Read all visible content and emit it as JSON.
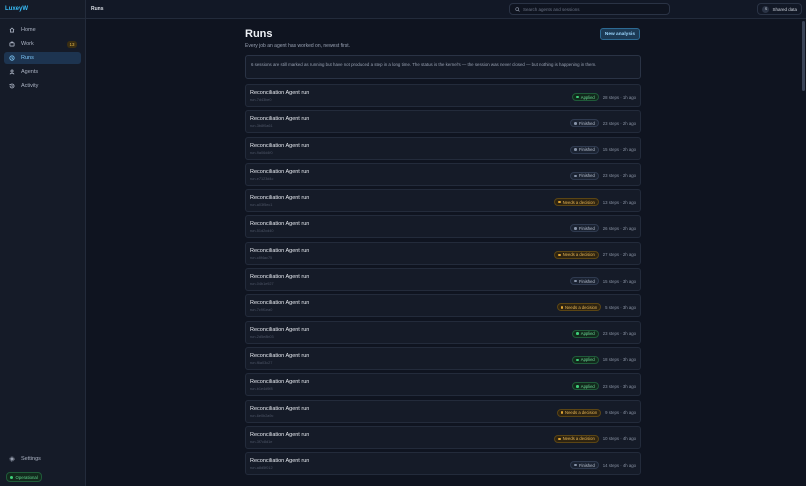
{
  "app": {
    "brand": "LuxeyW"
  },
  "sidebar": {
    "items": [
      {
        "label": "Home",
        "icon": "home-icon"
      },
      {
        "label": "Work",
        "icon": "briefcase-icon",
        "badge": "13"
      },
      {
        "label": "Runs",
        "icon": "clock-icon",
        "active": true
      },
      {
        "label": "Agents",
        "icon": "user-icon"
      },
      {
        "label": "Activity",
        "icon": "history-icon"
      }
    ],
    "settings_label": "Settings",
    "status_label": "Operational"
  },
  "topbar": {
    "breadcrumb": "Runs",
    "search_placeholder": "Search agents and sessions",
    "shared_avatar": "S",
    "shared_label": "Shared data"
  },
  "page": {
    "title": "Runs",
    "subtitle": "Every job an agent has worked on, newest first.",
    "new_button": "New analysis",
    "notice": "6 sessions are still marked as running but have not produced a step in a long time. The status is the kernel's — the session was never closed — but nothing is happening in them."
  },
  "runs": [
    {
      "title": "Reconciliation Agent run",
      "id": "run-7d43be0",
      "status": "Applied",
      "kind": "applied",
      "stats": "28 steps · 1h ago"
    },
    {
      "title": "Reconciliation Agent run",
      "id": "run-3b8f0a61",
      "status": "Finished",
      "kind": "finished",
      "stats": "23 steps · 2h ago"
    },
    {
      "title": "Reconciliation Agent run",
      "id": "run-9a06d4f0",
      "status": "Finished",
      "kind": "finished",
      "stats": "15 steps · 2h ago"
    },
    {
      "title": "Reconciliation Agent run",
      "id": "run-e7123d4c",
      "status": "Finished",
      "kind": "finished",
      "stats": "23 steps · 2h ago"
    },
    {
      "title": "Reconciliation Agent run",
      "id": "run-a03f5ec1",
      "status": "Needs a decision",
      "kind": "decision",
      "stats": "13 steps · 2h ago"
    },
    {
      "title": "Reconciliation Agent run",
      "id": "run-51d2cd40",
      "status": "Finished",
      "kind": "finished",
      "stats": "26 steps · 2h ago"
    },
    {
      "title": "Reconciliation Agent run",
      "id": "run-c8f4ac75",
      "status": "Needs a decision",
      "kind": "decision",
      "stats": "27 steps · 2h ago"
    },
    {
      "title": "Reconciliation Agent run",
      "id": "run-04b1e927",
      "status": "Finished",
      "kind": "finished",
      "stats": "15 steps · 3h ago"
    },
    {
      "title": "Reconciliation Agent run",
      "id": "run-7c9f1ea0",
      "status": "Needs a decision",
      "kind": "decision",
      "stats": "5 steps · 3h ago"
    },
    {
      "title": "Reconciliation Agent run",
      "id": "run-2d5e8b03",
      "status": "Applied",
      "kind": "applied",
      "stats": "23 steps · 3h ago"
    },
    {
      "title": "Reconciliation Agent run",
      "id": "run-f6a03c27",
      "status": "Applied",
      "kind": "applied",
      "stats": "18 steps · 3h ago"
    },
    {
      "title": "Reconciliation Agent run",
      "id": "run-b1e4d9f8",
      "status": "Applied",
      "kind": "applied",
      "stats": "23 steps · 3h ago"
    },
    {
      "title": "Reconciliation Agent run",
      "id": "run-6e0b2a9c",
      "status": "Needs a decision",
      "kind": "decision",
      "stats": "9 steps · 4h ago"
    },
    {
      "title": "Reconciliation Agent run",
      "id": "run-3f7c8d1e",
      "status": "Needs a decision",
      "kind": "decision",
      "stats": "10 steps · 4h ago"
    },
    {
      "title": "Reconciliation Agent run",
      "id": "run-a8d5f012",
      "status": "Finished",
      "kind": "finished",
      "stats": "14 steps · 4h ago"
    }
  ]
}
